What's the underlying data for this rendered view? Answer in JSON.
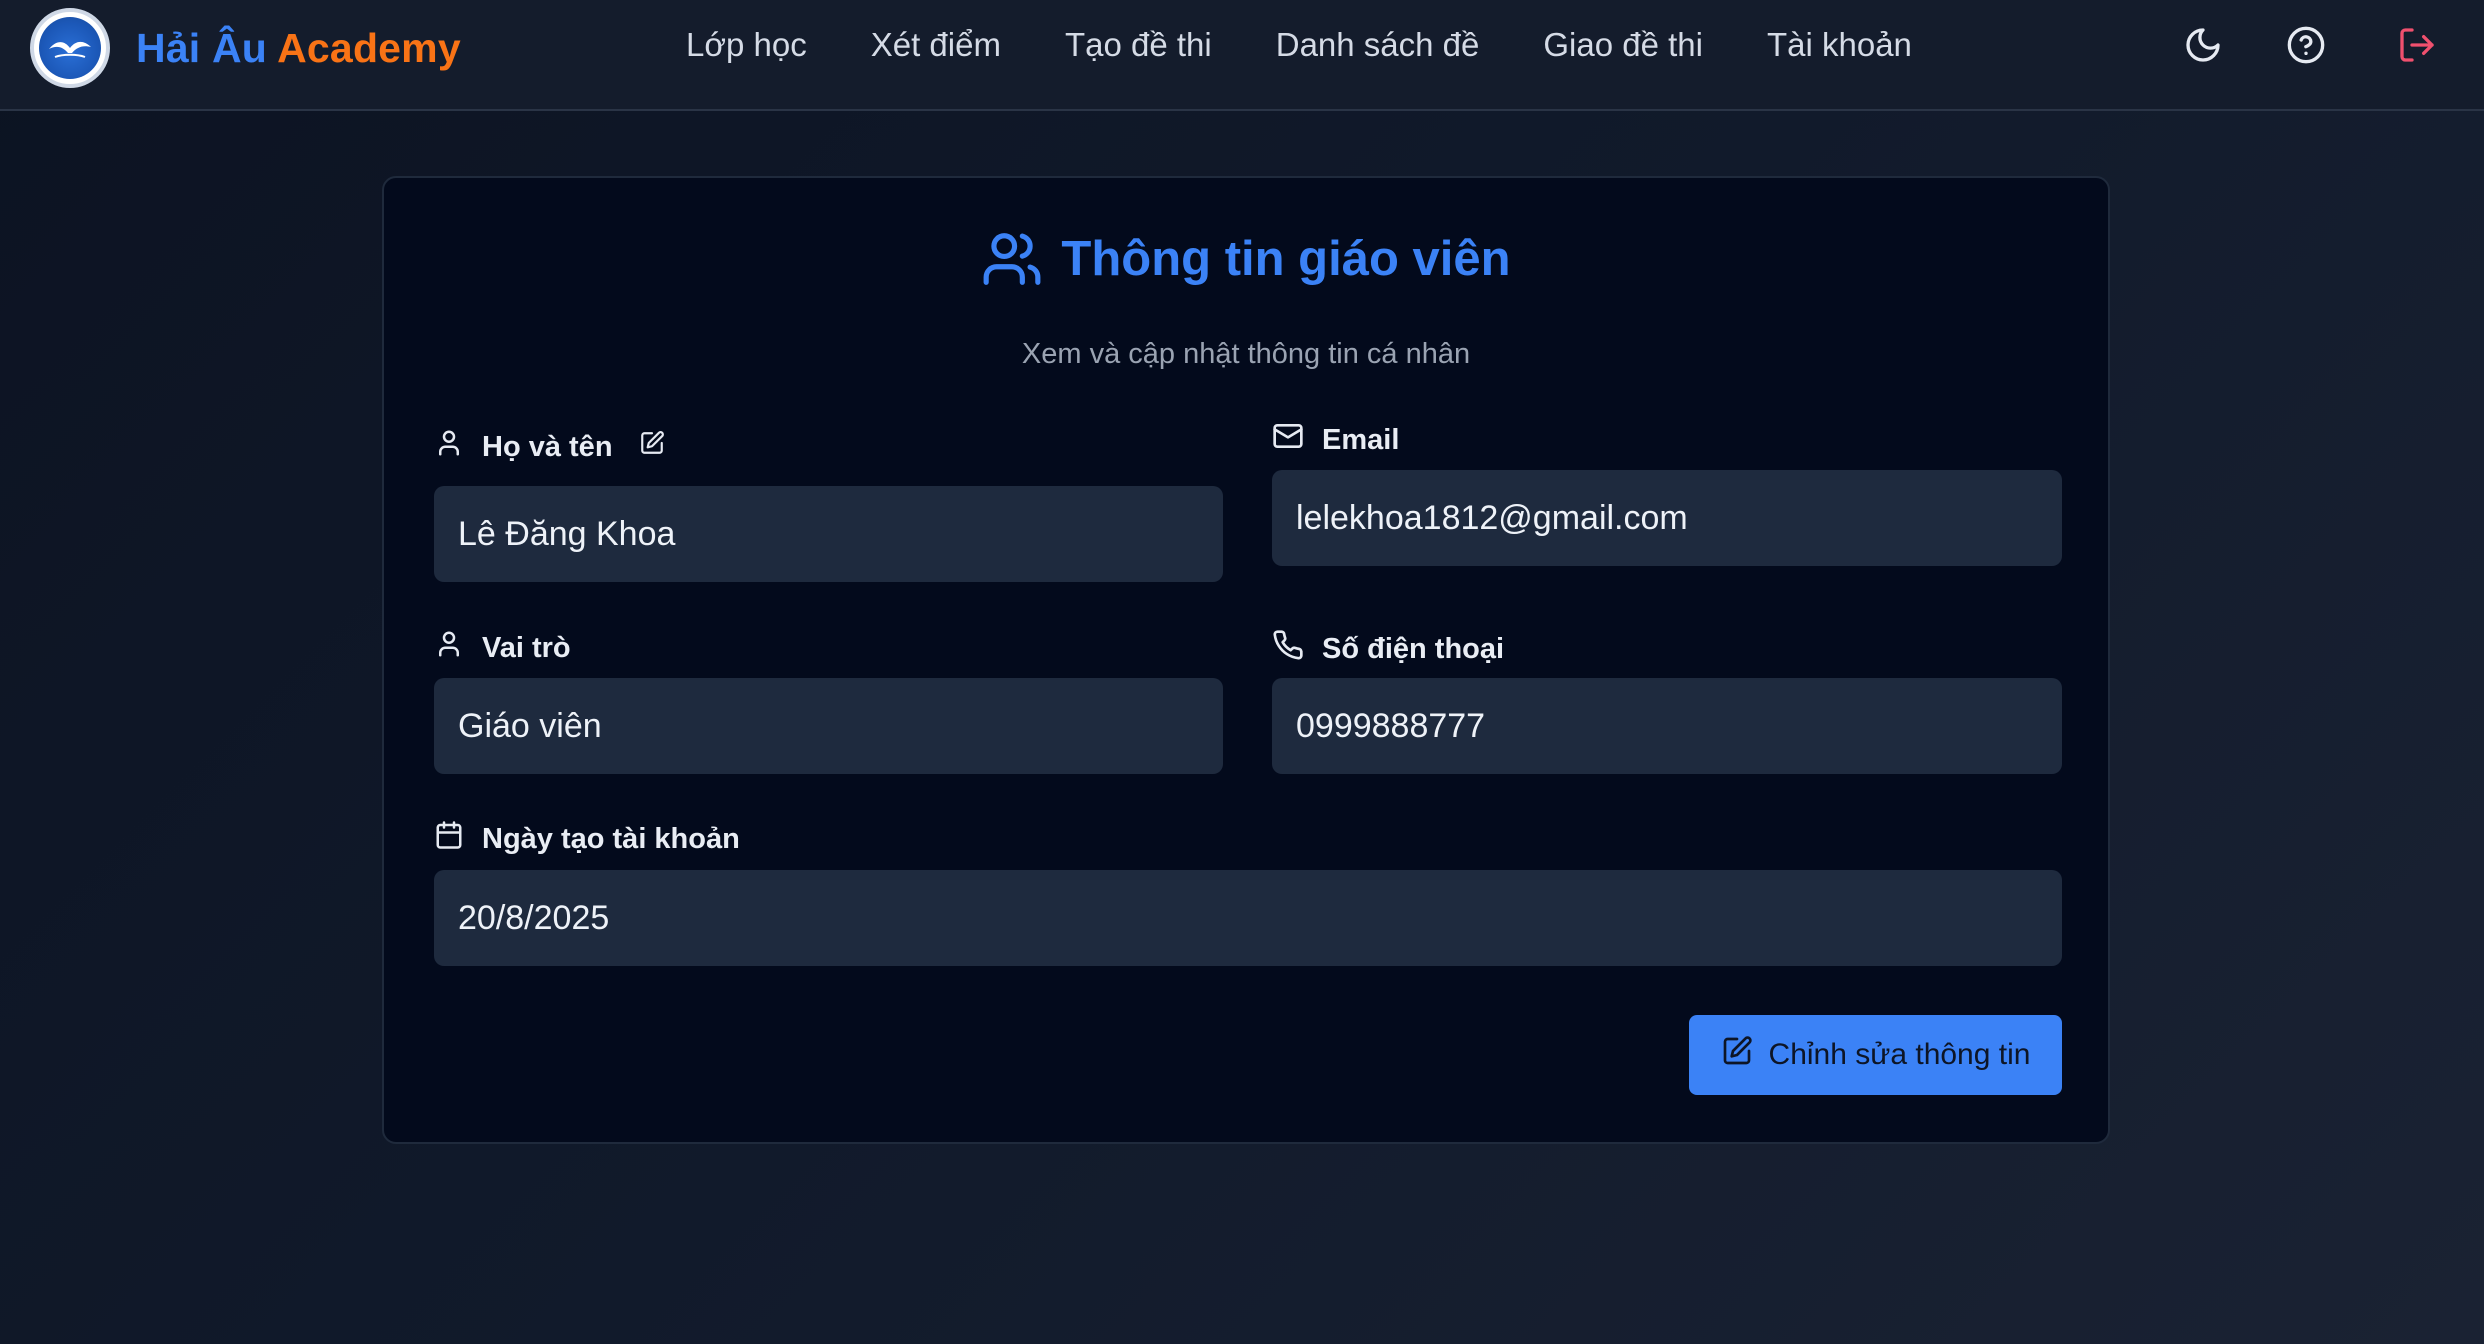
{
  "brand": {
    "part1": "Hải Âu",
    "part2": "Academy"
  },
  "nav": {
    "items": [
      {
        "label": "Lớp học"
      },
      {
        "label": "Xét điểm"
      },
      {
        "label": "Tạo đề thi"
      },
      {
        "label": "Danh sách đề"
      },
      {
        "label": "Giao đề thi"
      },
      {
        "label": "Tài khoản"
      }
    ]
  },
  "header_icons": [
    "moon-icon",
    "help-circle-icon",
    "logout-icon"
  ],
  "profile": {
    "title": "Thông tin giáo viên",
    "subtitle": "Xem và cập nhật thông tin cá nhân",
    "fields": {
      "name": {
        "label": "Họ và tên",
        "value": "Lê Đăng Khoa"
      },
      "email": {
        "label": "Email",
        "value": "lelekhoa1812@gmail.com"
      },
      "role": {
        "label": "Vai trò",
        "value": "Giáo viên"
      },
      "phone": {
        "label": "Số điện thoại",
        "value": "0999888777"
      },
      "created": {
        "label": "Ngày tạo tài khoản",
        "value": "20/8/2025"
      }
    },
    "edit_button": "Chỉnh sửa thông tin"
  },
  "colors": {
    "accent": "#3b82f6",
    "brand_orange": "#f97316",
    "logout": "#f0506e",
    "card_bg": "#030a1c",
    "input_bg": "#1e2a3e"
  }
}
